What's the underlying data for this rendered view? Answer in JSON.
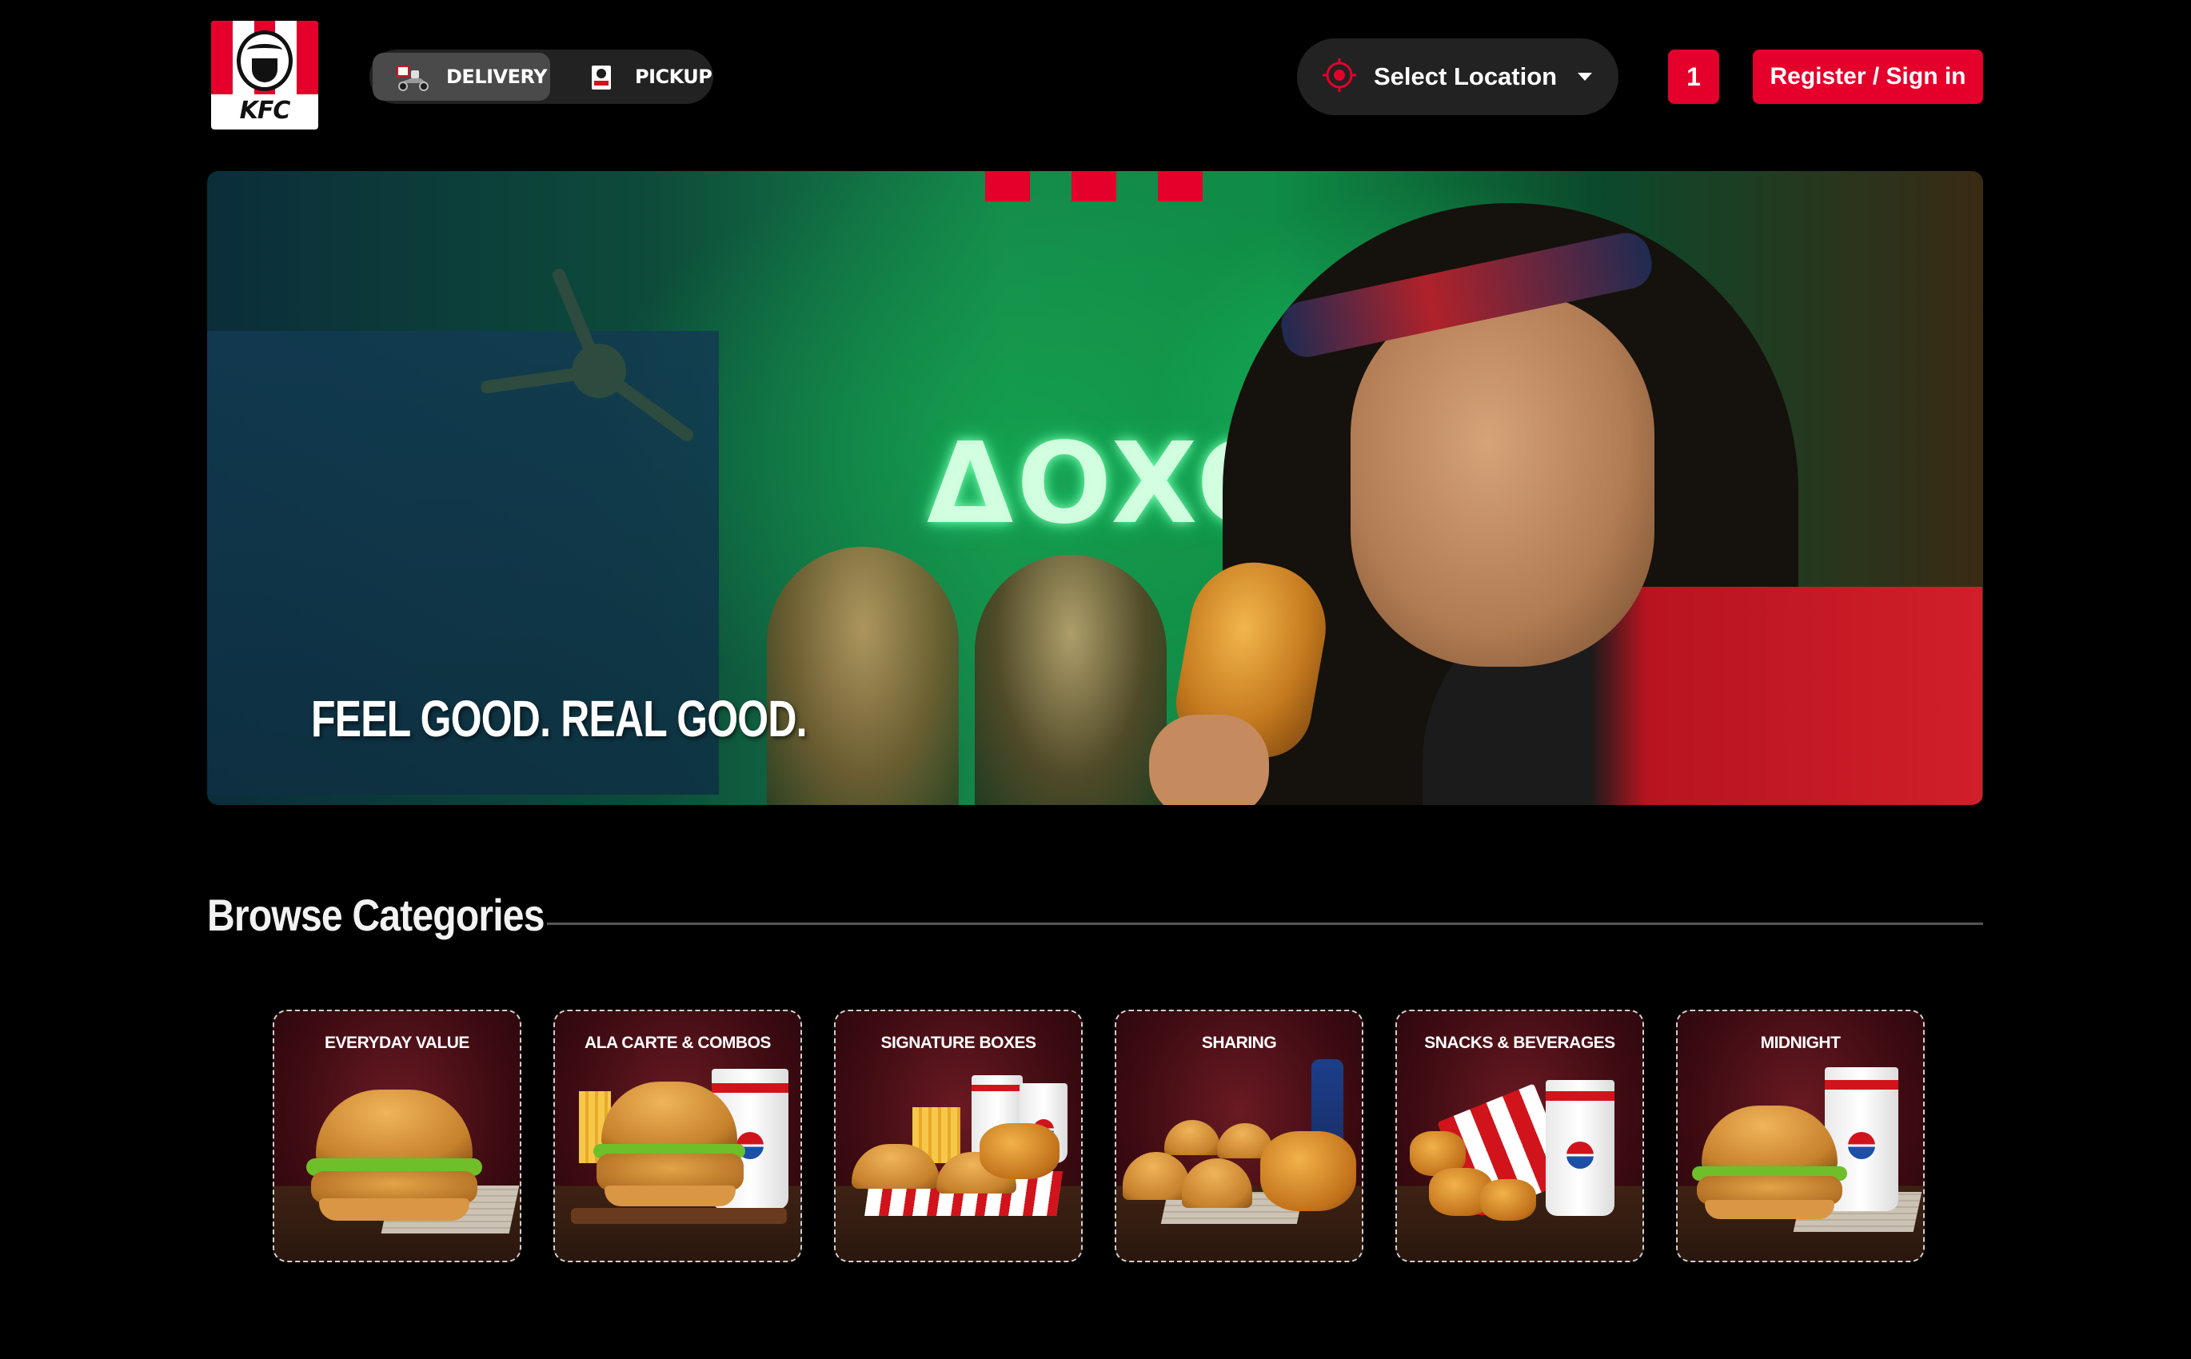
{
  "header": {
    "logo_text": "KFC",
    "delivery_label": "DELIVERY",
    "pickup_label": "PICKUP",
    "active_mode": "DELIVERY",
    "location_label": "Select Location",
    "cart_count": "1",
    "signin_label": "Register / Sign in"
  },
  "hero": {
    "tagline": "FEEL GOOD. REAL GOOD.",
    "neon_text": "ΔOXO"
  },
  "categories": {
    "title": "Browse Categories",
    "items": [
      {
        "label": "EVERYDAY VALUE"
      },
      {
        "label": "ALA CARTE & COMBOS"
      },
      {
        "label": "SIGNATURE BOXES"
      },
      {
        "label": "SHARING"
      },
      {
        "label": "SNACKS & BEVERAGES"
      },
      {
        "label": "MIDNIGHT"
      }
    ]
  },
  "colors": {
    "brand_red": "#e4002b",
    "background": "#000000",
    "pill_bg": "#222222"
  },
  "icons": {
    "location": "crosshair-icon",
    "dropdown": "chevron-down-icon",
    "delivery": "delivery-scooter-icon",
    "pickup": "pickup-bag-icon"
  }
}
